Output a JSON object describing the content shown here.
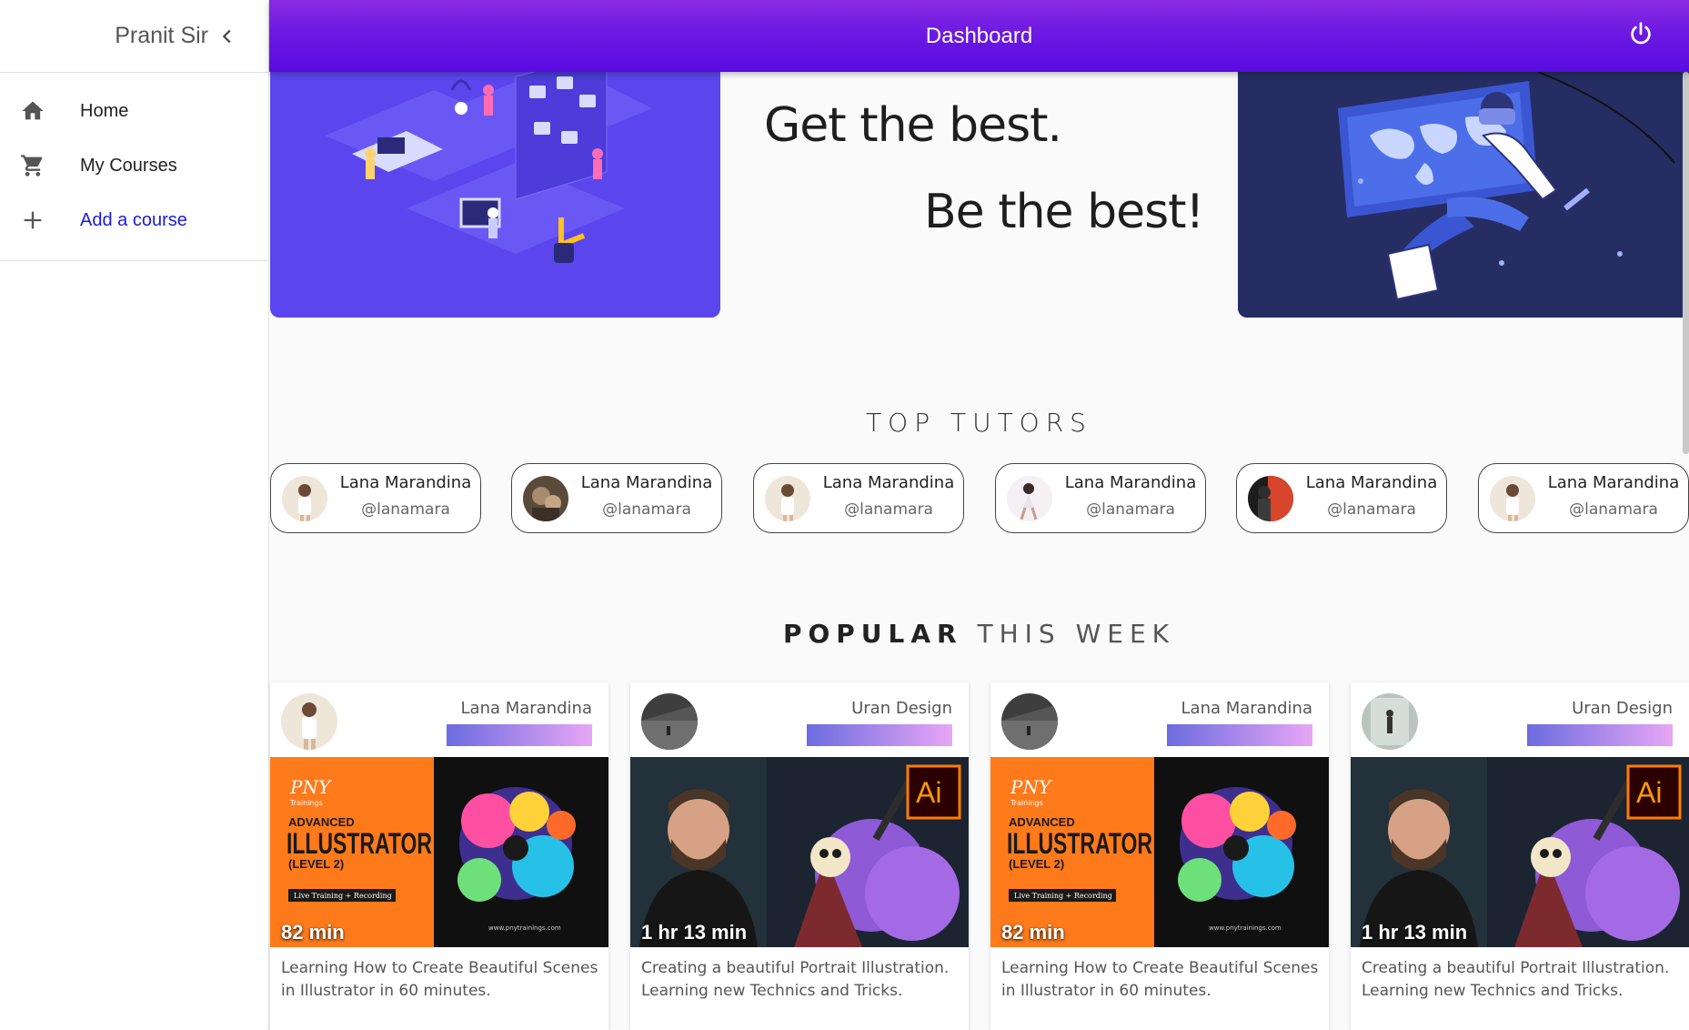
{
  "sidebar": {
    "user": "Pranit Sir",
    "items": [
      {
        "label": "Home",
        "icon": "home-icon"
      },
      {
        "label": "My Courses",
        "icon": "cart-icon"
      },
      {
        "label": "Add a course",
        "icon": "plus-icon"
      }
    ]
  },
  "appbar": {
    "title": "Dashboard",
    "icon": "power-icon"
  },
  "hero": {
    "line1": "Get the best.",
    "line2": "Be the best!"
  },
  "tutors_section": {
    "title": "TOP TUTORS"
  },
  "tutors": [
    {
      "name": "Lana Marandina",
      "handle": "@lanamara"
    },
    {
      "name": "Lana Marandina",
      "handle": "@lanamara"
    },
    {
      "name": "Lana Marandina",
      "handle": "@lanamara"
    },
    {
      "name": "Lana Marandina",
      "handle": "@lanamara"
    },
    {
      "name": "Lana Marandina",
      "handle": "@lanamara"
    },
    {
      "name": "Lana Marandina",
      "handle": "@lanamara"
    }
  ],
  "popular_section": {
    "title_bold": "POPULAR",
    "title_light": "THIS WEEK"
  },
  "courses": [
    {
      "author": "Lana Marandina",
      "duration": "82 min",
      "description": "Learning How to Create Beautiful Scenes in Illustrator in 60 minutes."
    },
    {
      "author": "Uran Design",
      "duration": "1 hr 13 min",
      "description": "Creating a beautiful Portrait Illustration. Learning new Technics and Tricks."
    },
    {
      "author": "Lana Marandina",
      "duration": "82 min",
      "description": "Learning How to Create Beautiful Scenes in Illustrator in 60 minutes."
    },
    {
      "author": "Uran Design",
      "duration": "1 hr 13 min",
      "description": "Creating a beautiful Portrait Illustration. Learning new Technics and Tricks."
    }
  ],
  "thumbs": {
    "pny": {
      "brand": "PNY",
      "brand_sub": "Trainings",
      "kicker": "ADVANCED",
      "headline": "ILLUSTRATOR",
      "level": "(LEVEL 2)",
      "tag": "Live Training + Recording",
      "site": "www.pnytrainings.com"
    },
    "ai": {
      "badge": "Ai"
    }
  },
  "colors": {
    "appbar_start": "#8a2be2",
    "appbar_end": "#5a0be0",
    "hero_left": "#5a46ec",
    "hero_right": "#262d63",
    "link": "#1a1adf",
    "orange": "#ff7a1a"
  }
}
